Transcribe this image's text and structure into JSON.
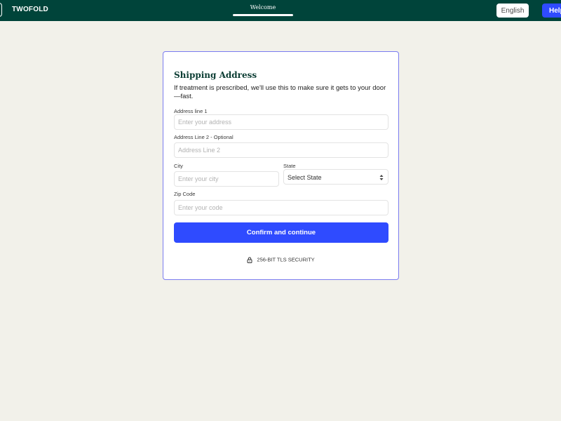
{
  "header": {
    "brand": "TWOFOLD",
    "progress": {
      "label": "Welcome",
      "fraction": 1.0
    },
    "language_button": "English",
    "help_button": "Help"
  },
  "form": {
    "title": "Shipping Address",
    "subtitle": "If treatment is prescribed, we'll use this to make sure it gets to your door—fast.",
    "address1": {
      "label": "Address line 1",
      "placeholder": "Enter your address",
      "value": ""
    },
    "address2": {
      "label": "Address Line 2 - Optional",
      "placeholder": "Address Line 2",
      "value": ""
    },
    "city": {
      "label": "City",
      "placeholder": "Enter your city",
      "value": ""
    },
    "state": {
      "label": "State",
      "selected": "Select State"
    },
    "zip": {
      "label": "Zip Code",
      "placeholder": "Enter your code",
      "value": ""
    },
    "submit_label": "Confirm and continue",
    "security_text": "256-BIT TLS SECURITY"
  },
  "colors": {
    "header_bg": "#00443a",
    "accent": "#2f4bff",
    "page_bg": "#f2f1ea",
    "card_border": "#7a7cf0"
  },
  "icons": {
    "lock": "lock-icon",
    "select_arrows": "sort-arrows-icon"
  }
}
